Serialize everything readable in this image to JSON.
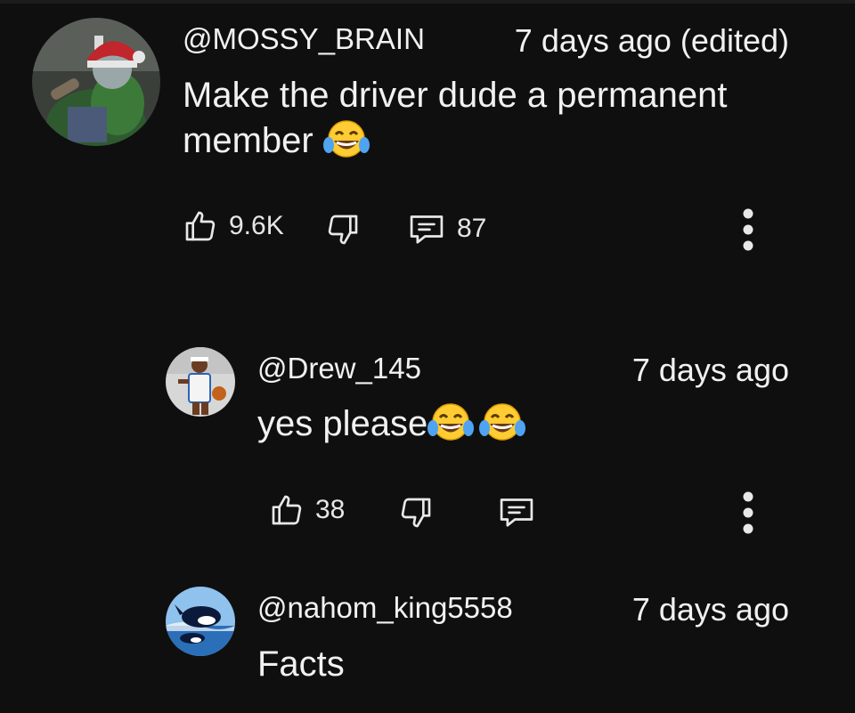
{
  "comments": [
    {
      "handle": "@MOSSY_BRAIN",
      "time": "7 days ago (edited)",
      "text": "Make the driver dude a permanent member",
      "emoji": [
        "face-with-tears-of-joy"
      ],
      "likes": "9.6K",
      "replies": "87",
      "avatar": "user-avatar-mossy-brain"
    },
    {
      "handle": "@Drew_145",
      "time": "7 days ago",
      "text": "yes please",
      "emoji": [
        "face-with-tears-of-joy",
        "face-with-tears-of-joy"
      ],
      "likes": "38",
      "replies": "",
      "avatar": "user-avatar-drew-145"
    },
    {
      "handle": "@nahom_king5558",
      "time": "7 days ago",
      "text": "Facts",
      "avatar": "user-avatar-nahom-king5558"
    }
  ],
  "icons": {
    "like": "thumbs-up-icon",
    "dislike": "thumbs-down-icon",
    "reply": "comment-icon",
    "more": "more-vertical-icon"
  },
  "colors": {
    "background": "#0f0f10",
    "text": "#f1f1f1",
    "emoji_face": "#ffcc33",
    "emoji_tears": "#4fa3f0"
  }
}
